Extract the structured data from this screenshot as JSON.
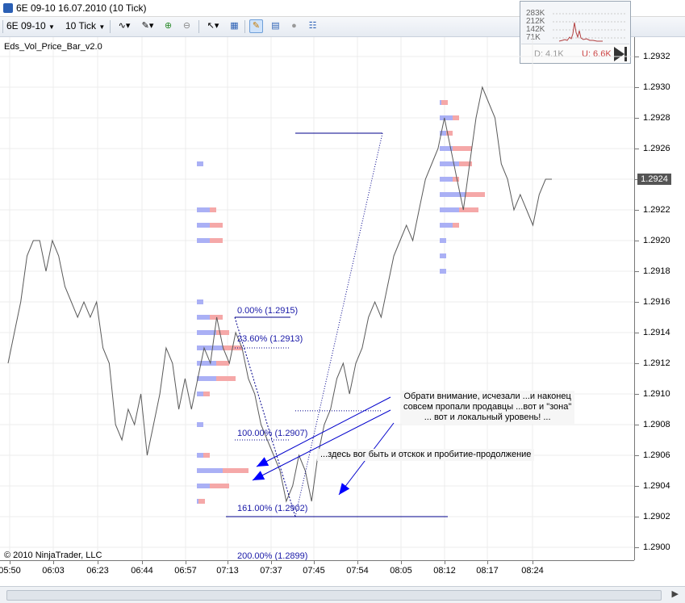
{
  "window": {
    "title": "6E 09-10  16.07.2010 (10 Tick)"
  },
  "toolbar": {
    "instrument": "6E 09-10",
    "interval": "10 Tick",
    "dropdown_icon": "chevron-down-icon"
  },
  "indicator_label": "Eds_Vol_Price_Bar_v2.0",
  "copyright": "© 2010 NinjaTrader, LLC",
  "volume_panel": {
    "levels": [
      "283K",
      "212K",
      "142K",
      "71K"
    ],
    "down_label": "D: 4.1K",
    "up_label": "U: 6.6K"
  },
  "price_axis": {
    "labels": [
      "1.2932",
      "1.2930",
      "1.2928",
      "1.2926",
      "1.2924",
      "1.2922",
      "1.2920",
      "1.2918",
      "1.2916",
      "1.2914",
      "1.2912",
      "1.2910",
      "1.2908",
      "1.2906",
      "1.2904",
      "1.2902",
      "1.2900"
    ],
    "current": "1.2924"
  },
  "time_axis": {
    "labels": [
      "05:50",
      "06:03",
      "06:23",
      "06:44",
      "06:57",
      "07:13",
      "07:37",
      "07:45",
      "07:54",
      "08:05",
      "08:12",
      "08:17",
      "08:24"
    ]
  },
  "fib_levels": [
    {
      "label": "0.00% (1.2915)",
      "price": 1.2915
    },
    {
      "label": "23.60% (1.2913)",
      "price": 1.2913
    },
    {
      "label": "100.00% (1.2907)",
      "price": 1.2907
    },
    {
      "label": "161.00% (1.2902)",
      "price": 1.2902
    },
    {
      "label": "200.00% (1.2899)",
      "price": 1.2899
    }
  ],
  "notes": {
    "note1": "Обрати внимание, исчезали ...и наконец\nсовсем пропали продавцы ...вот и \"зона\"\n... вот и локальный уровень! ...",
    "note2": "...здесь вог быть и отскок и пробитие-продолжение"
  },
  "colors": {
    "price_line": "#5a5a5a",
    "buy_volume": "#aab0f5",
    "sell_volume": "#f5a8a8",
    "annotation": "#00008b",
    "current_price_bg": "#555555"
  },
  "chart_data": {
    "type": "line",
    "ylim": [
      1.2899,
      1.2933
    ],
    "price_series": [
      1.2912,
      1.2914,
      1.2916,
      1.2919,
      1.292,
      1.292,
      1.2918,
      1.292,
      1.2919,
      1.2917,
      1.2916,
      1.2915,
      1.2916,
      1.2915,
      1.2916,
      1.2913,
      1.2912,
      1.2908,
      1.2907,
      1.2909,
      1.2908,
      1.291,
      1.2906,
      1.2908,
      1.291,
      1.2913,
      1.2912,
      1.2909,
      1.2911,
      1.2909,
      1.2911,
      1.2913,
      1.2912,
      1.2915,
      1.2913,
      1.2912,
      1.2914,
      1.2913,
      1.2911,
      1.291,
      1.2908,
      1.2907,
      1.2906,
      1.2905,
      1.2903,
      1.2904,
      1.2906,
      1.2905,
      1.2903,
      1.2906,
      1.2908,
      1.2909,
      1.2911,
      1.2912,
      1.291,
      1.2912,
      1.2913,
      1.2915,
      1.2916,
      1.2915,
      1.2917,
      1.2919,
      1.292,
      1.2921,
      1.292,
      1.2922,
      1.2924,
      1.2925,
      1.2926,
      1.2928,
      1.2926,
      1.2924,
      1.2922,
      1.2925,
      1.2928,
      1.293,
      1.2929,
      1.2928,
      1.2925,
      1.2924,
      1.2922,
      1.2923,
      1.2922,
      1.2921,
      1.2923,
      1.2924,
      1.2924
    ],
    "volume_profiles": [
      {
        "x_label": "06:57",
        "levels": [
          {
            "price": 1.2925,
            "buy": 1,
            "sell": 0
          },
          {
            "price": 1.2922,
            "buy": 2,
            "sell": 1
          },
          {
            "price": 1.2921,
            "buy": 2,
            "sell": 2
          },
          {
            "price": 1.292,
            "buy": 2,
            "sell": 2
          },
          {
            "price": 1.2916,
            "buy": 1,
            "sell": 0
          },
          {
            "price": 1.2915,
            "buy": 2,
            "sell": 2
          },
          {
            "price": 1.2914,
            "buy": 3,
            "sell": 2
          },
          {
            "price": 1.2913,
            "buy": 4,
            "sell": 3
          },
          {
            "price": 1.2912,
            "buy": 3,
            "sell": 2
          },
          {
            "price": 1.2911,
            "buy": 3,
            "sell": 3
          },
          {
            "price": 1.291,
            "buy": 1,
            "sell": 1
          },
          {
            "price": 1.2908,
            "buy": 1,
            "sell": 0
          },
          {
            "price": 1.2906,
            "buy": 1,
            "sell": 1
          },
          {
            "price": 1.2905,
            "buy": 4,
            "sell": 4
          },
          {
            "price": 1.2904,
            "buy": 2,
            "sell": 3
          },
          {
            "price": 1.2903,
            "buy": 0,
            "sell": 1
          }
        ]
      },
      {
        "x_label": "08:12",
        "levels": [
          {
            "price": 1.2929,
            "buy": 0,
            "sell": 1
          },
          {
            "price": 1.2928,
            "buy": 2,
            "sell": 1
          },
          {
            "price": 1.2927,
            "buy": 1,
            "sell": 1
          },
          {
            "price": 1.2926,
            "buy": 2,
            "sell": 3
          },
          {
            "price": 1.2925,
            "buy": 3,
            "sell": 2
          },
          {
            "price": 1.2924,
            "buy": 2,
            "sell": 1
          },
          {
            "price": 1.2923,
            "buy": 4,
            "sell": 3
          },
          {
            "price": 1.2922,
            "buy": 3,
            "sell": 3
          },
          {
            "price": 1.2921,
            "buy": 2,
            "sell": 1
          },
          {
            "price": 1.292,
            "buy": 1,
            "sell": 0
          },
          {
            "price": 1.2919,
            "buy": 1,
            "sell": 0
          },
          {
            "price": 1.2918,
            "buy": 1,
            "sell": 0
          }
        ]
      }
    ]
  }
}
